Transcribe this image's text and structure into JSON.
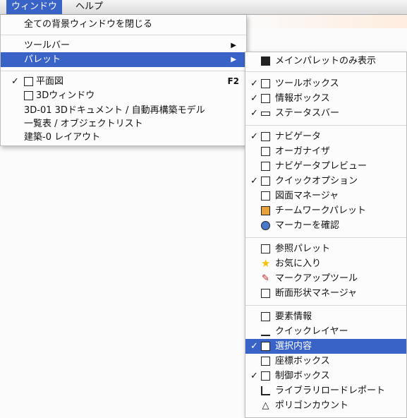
{
  "menubar": {
    "window": "ウィンドウ",
    "help": "ヘルプ"
  },
  "window_menu": {
    "close_all": "全ての背景ウィンドウを閉じる",
    "toolbar": "ツールバー",
    "palette": "パレット",
    "floor_plan": "平面図",
    "floor_plan_shortcut": "F2",
    "window_3d": "3Dウィンドウ",
    "doc_3d": "3D-01 3Dドキュメント / 自動再構築モデル",
    "object_list": "一覧表 /  オブジェクトリスト",
    "layout": "建築-0 レイアウト",
    "check": "✓",
    "submenu_arrow": "▶"
  },
  "palette_menu": {
    "check": "✓",
    "items": [
      "メインパレットのみ表示",
      "ツールボックス",
      "情報ボックス",
      "ステータスバー",
      "ナビゲータ",
      "オーガナイザ",
      "ナビゲータプレビュー",
      "クイックオプション",
      "図面マネージャ",
      "チームワークパレット",
      "マーカーを確認",
      "参照パレット",
      "お気に入り",
      "マークアップツール",
      "断面形状マネージャ",
      "要素情報",
      "クイックレイヤー",
      "選択内容",
      "座標ボックス",
      "制御ボックス",
      "ライブラリロードレポート",
      "ポリゴンカウント"
    ]
  },
  "colors": {
    "highlight": "#3a63c8",
    "star": "#f2c200"
  }
}
